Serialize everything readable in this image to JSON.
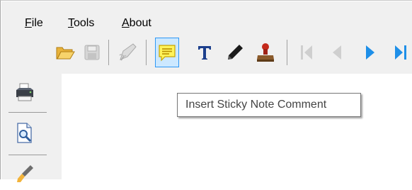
{
  "menu": {
    "file": {
      "accel": "F",
      "rest": "ile"
    },
    "tools": {
      "accel": "T",
      "rest": "ools"
    },
    "about": {
      "accel": "A",
      "rest": "bout"
    }
  },
  "toolbar": {
    "buttons": [
      {
        "icon": "open-folder-icon"
      },
      {
        "icon": "save-disk-icon",
        "state": "disabled"
      },
      {
        "icon": "signature-pen-icon",
        "state": "disabled"
      },
      {
        "icon": "sticky-note-icon",
        "state": "hover"
      },
      {
        "icon": "text-t-icon"
      },
      {
        "icon": "pencil-icon"
      },
      {
        "icon": "stamp-icon"
      },
      {
        "icon": "first-page-icon",
        "state": "disabled"
      },
      {
        "icon": "previous-page-icon",
        "state": "disabled"
      },
      {
        "icon": "next-page-icon"
      },
      {
        "icon": "last-page-icon"
      }
    ]
  },
  "leftbar": {
    "buttons": [
      {
        "icon": "printer-icon"
      },
      {
        "icon": "print-preview-icon"
      },
      {
        "icon": "brush-icon"
      }
    ]
  },
  "tooltip": {
    "text": "Insert Sticky Note Comment"
  },
  "colors": {
    "chrome": "#f0f0f0",
    "hover_fill": "#cce8ff",
    "hover_border": "#2e98f5",
    "accent_blue": "#1e8fe8",
    "disabled_gray": "#c8c8c8"
  }
}
